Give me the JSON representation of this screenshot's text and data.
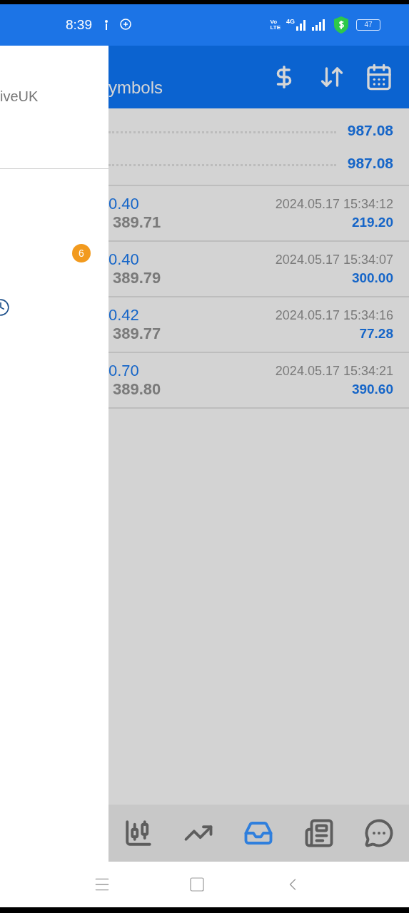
{
  "status_bar": {
    "time": "8:39",
    "volte_top": "Vo",
    "volte_bottom": "LTE",
    "network": "4G",
    "battery": "47"
  },
  "drawer": {
    "account": "iveUK",
    "badge": "6"
  },
  "app_bar": {
    "subtitle": "ymbols"
  },
  "summary": [
    "987.08",
    "987.08"
  ],
  "trades": [
    {
      "price_1": "0.40",
      "price_2": "389.71",
      "time": "2024.05.17 15:34:12",
      "profit": "219.20"
    },
    {
      "price_1": "0.40",
      "price_2": "389.79",
      "time": "2024.05.17 15:34:07",
      "profit": "300.00"
    },
    {
      "price_1": "0.42",
      "price_2": "389.77",
      "time": "2024.05.17 15:34:16",
      "profit": "77.28"
    },
    {
      "price_1": "0.70",
      "price_2": "389.80",
      "time": "2024.05.17 15:34:21",
      "profit": "390.60"
    }
  ],
  "bottom_nav": [
    {
      "kind": "chart",
      "selected": false
    },
    {
      "kind": "trade",
      "selected": false
    },
    {
      "kind": "history",
      "selected": true
    },
    {
      "kind": "news",
      "selected": false
    },
    {
      "kind": "chat",
      "selected": false
    }
  ]
}
